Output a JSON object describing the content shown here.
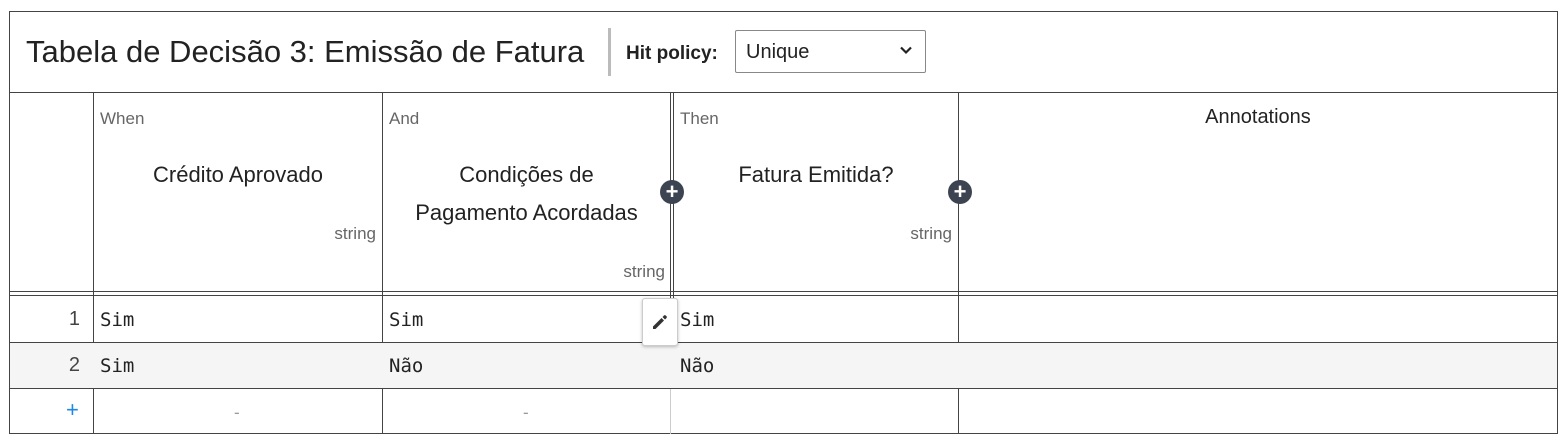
{
  "title": "Tabela de Decisão 3: Emissão de Fatura",
  "hit_policy": {
    "label": "Hit policy:",
    "value": "Unique"
  },
  "columns": [
    {
      "kind": "When",
      "name": "Crédito Aprovado",
      "type": "string"
    },
    {
      "kind": "And",
      "name_line1": "Condições de",
      "name_line2": "Pagamento Acordadas",
      "type": "string"
    },
    {
      "kind": "Then",
      "name": "Fatura Emitida?",
      "type": "string"
    }
  ],
  "annotations_label": "Annotations",
  "rows": [
    {
      "num": "1",
      "c1": "Sim",
      "c2": "Sim",
      "c3": "Sim"
    },
    {
      "num": "2",
      "c1": "Sim",
      "c2": "Não",
      "c3": "Não"
    }
  ],
  "add_row": {
    "plus": "+",
    "dash": "-"
  },
  "icons": {
    "add_column": "plus-circle-icon",
    "edit": "pencil-icon",
    "dropdown": "chevron-down-icon"
  }
}
